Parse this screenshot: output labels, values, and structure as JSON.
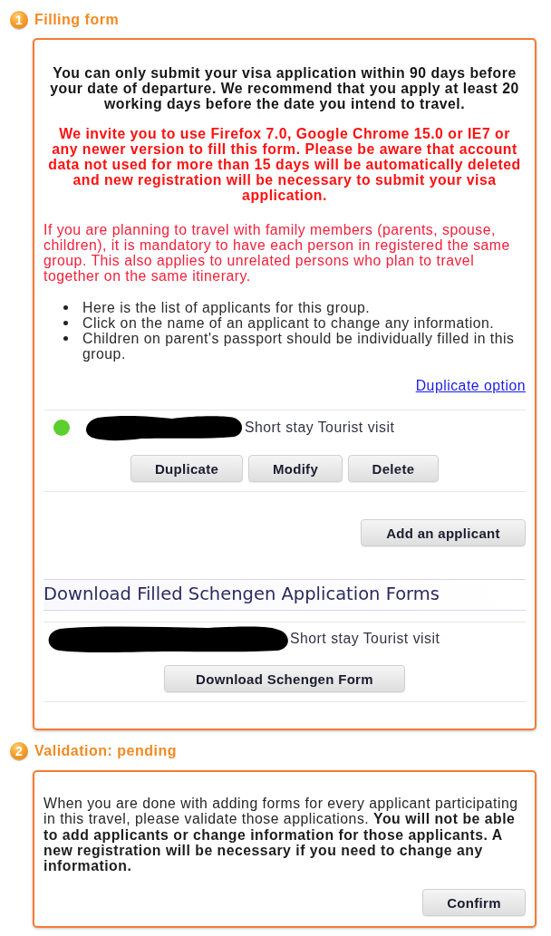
{
  "filling_step": {
    "number": "1",
    "title": "Filling form"
  },
  "filling_form": {
    "notice": "You can only submit your visa application within 90 days before your date of departure. We recommend that you apply at least 20 working days before the date you intend to travel.",
    "browser_warning": "We invite you to use Firefox 7.0, Google Chrome 15.0 or IE7 or any newer version to fill this form. Please be aware that account data not used for more than 15 days will be automatically deleted and new registration will be necessary to submit your visa application.",
    "family_note": "If you are planning to travel with family members (parents, spouse, children), it is mandatory to have each person in registered the same group. This also applies to unrelated persons who plan to travel together on the same itinerary.",
    "instructions": [
      "Here is the list of applicants for this group.",
      "Click on the name of an applicant to change any information.",
      "Children on parent's passport should be individually filled in this group."
    ],
    "duplicate_option_link": "Duplicate option",
    "applicants": [
      {
        "color": "#5ccf2e",
        "name_redacted": true,
        "visa_type": "Short stay Tourist visit",
        "actions": [
          "Duplicate",
          "Modify",
          "Delete"
        ]
      }
    ],
    "add_button": "Add an applicant",
    "download_heading": "Download Filled Schengen Application Forms",
    "download_forms": [
      {
        "name_redacted": true,
        "visa_type": "Short stay Tourist visit",
        "button": "Download Schengen Form"
      }
    ]
  },
  "validation_step": {
    "number": "2",
    "title": "Validation: pending"
  },
  "validation": {
    "text": "When you are done with adding forms for every applicant participating in this travel, please validate those applications. **You will not be able to add applicants or change information for those applicants. A new registration will be necessary if you need to change any information.**",
    "button": "Confirm"
  }
}
